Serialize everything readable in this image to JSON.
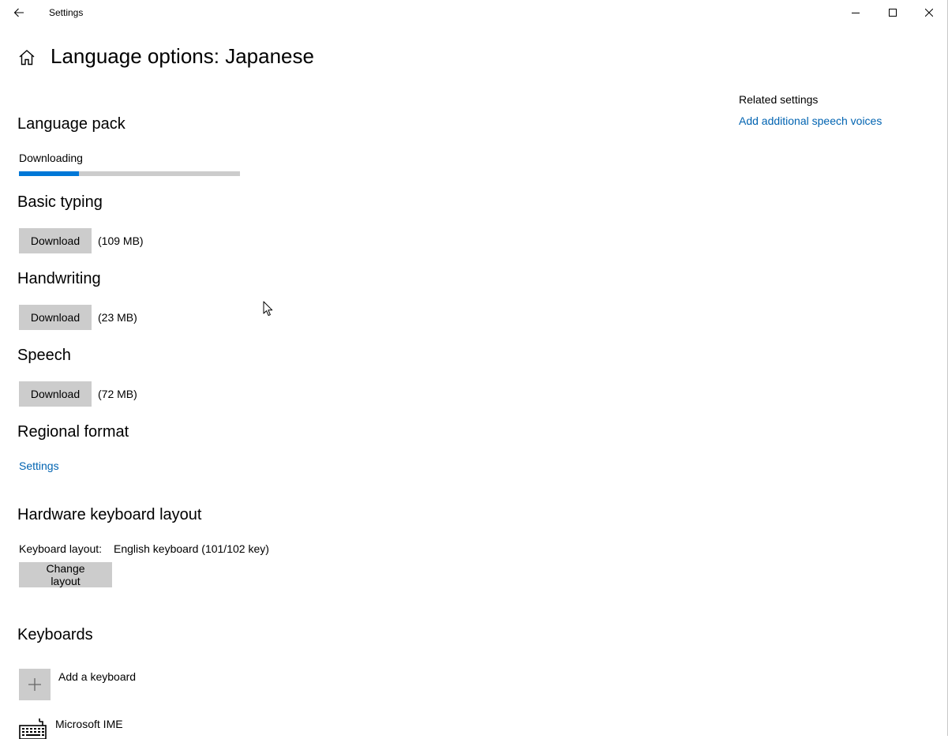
{
  "titlebar": {
    "title": "Settings",
    "icons": {
      "back": "back-arrow-icon",
      "minimize": "minimize-icon",
      "maximize": "maximize-icon",
      "close": "close-icon"
    }
  },
  "header": {
    "title": "Language options: Japanese",
    "icon": "home-icon"
  },
  "language_pack": {
    "heading": "Language pack",
    "status": "Downloading",
    "progress_fraction": 0.27,
    "accent_color": "#0078d7"
  },
  "basic_typing": {
    "heading": "Basic typing",
    "button": "Download",
    "size": "(109 MB)"
  },
  "handwriting": {
    "heading": "Handwriting",
    "button": "Download",
    "size": "(23 MB)"
  },
  "speech": {
    "heading": "Speech",
    "button": "Download",
    "size": "(72 MB)"
  },
  "regional_format": {
    "heading": "Regional format",
    "link": "Settings"
  },
  "hardware_keyboard": {
    "heading": "Hardware keyboard layout",
    "label": "Keyboard layout:",
    "value": "English keyboard (101/102 key)",
    "button": "Change layout"
  },
  "keyboards": {
    "heading": "Keyboards",
    "add_label": "Add a keyboard",
    "add_icon": "plus-icon",
    "items": [
      {
        "name": "Microsoft IME",
        "icon": "keyboard-icon"
      }
    ]
  },
  "related": {
    "heading": "Related settings",
    "link": "Add additional speech voices",
    "link_color": "#0063b1"
  }
}
